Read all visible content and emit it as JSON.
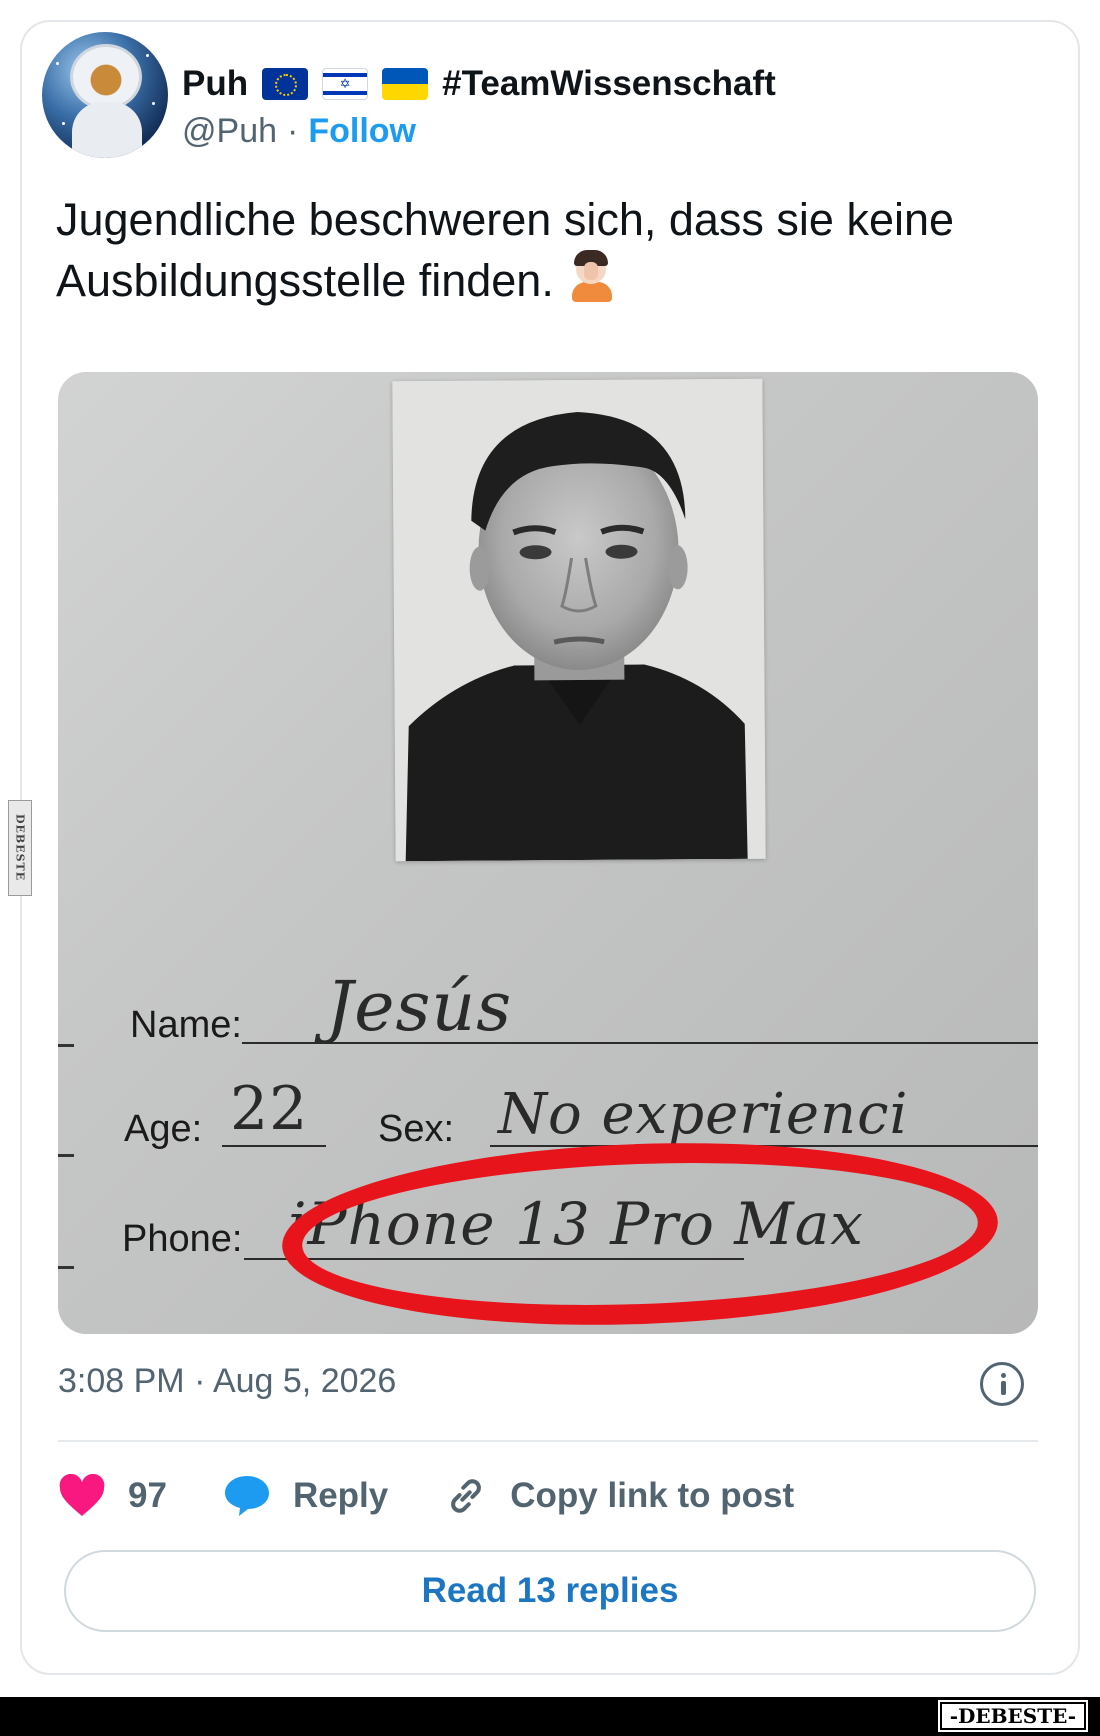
{
  "user": {
    "display_name": "Puh",
    "flags": [
      "eu-flag-icon",
      "israel-flag-icon",
      "ukraine-flag-icon"
    ],
    "hashtag": "#TeamWissenschaft",
    "handle": "@Puh",
    "separator": "·",
    "follow_label": "Follow"
  },
  "tweet": {
    "text": "Jugendliche beschweren sich, dass sie keine Ausbildungsstelle finden.",
    "emoji": "facepalm-person-icon"
  },
  "form": {
    "name_label": "Name:",
    "name_value": "Jesús",
    "age_label": "Age:",
    "age_value": "22",
    "sex_label": "Sex:",
    "sex_value": "No experienci",
    "phone_label": "Phone:",
    "phone_value": "iPhone 13 Pro Max"
  },
  "meta": {
    "timestamp": "3:08 PM · Aug 5, 2026"
  },
  "actions": {
    "like_count": "97",
    "reply_label": "Reply",
    "copy_link_label": "Copy link to post"
  },
  "read_replies_label": "Read 13 replies",
  "watermark": {
    "side": "DEBESTE",
    "bottom": "-DEBESTE-"
  },
  "colors": {
    "accent": "#1d9bf0",
    "like": "#f91880",
    "muted": "#536471",
    "highlight_oval": "#e8141b"
  }
}
